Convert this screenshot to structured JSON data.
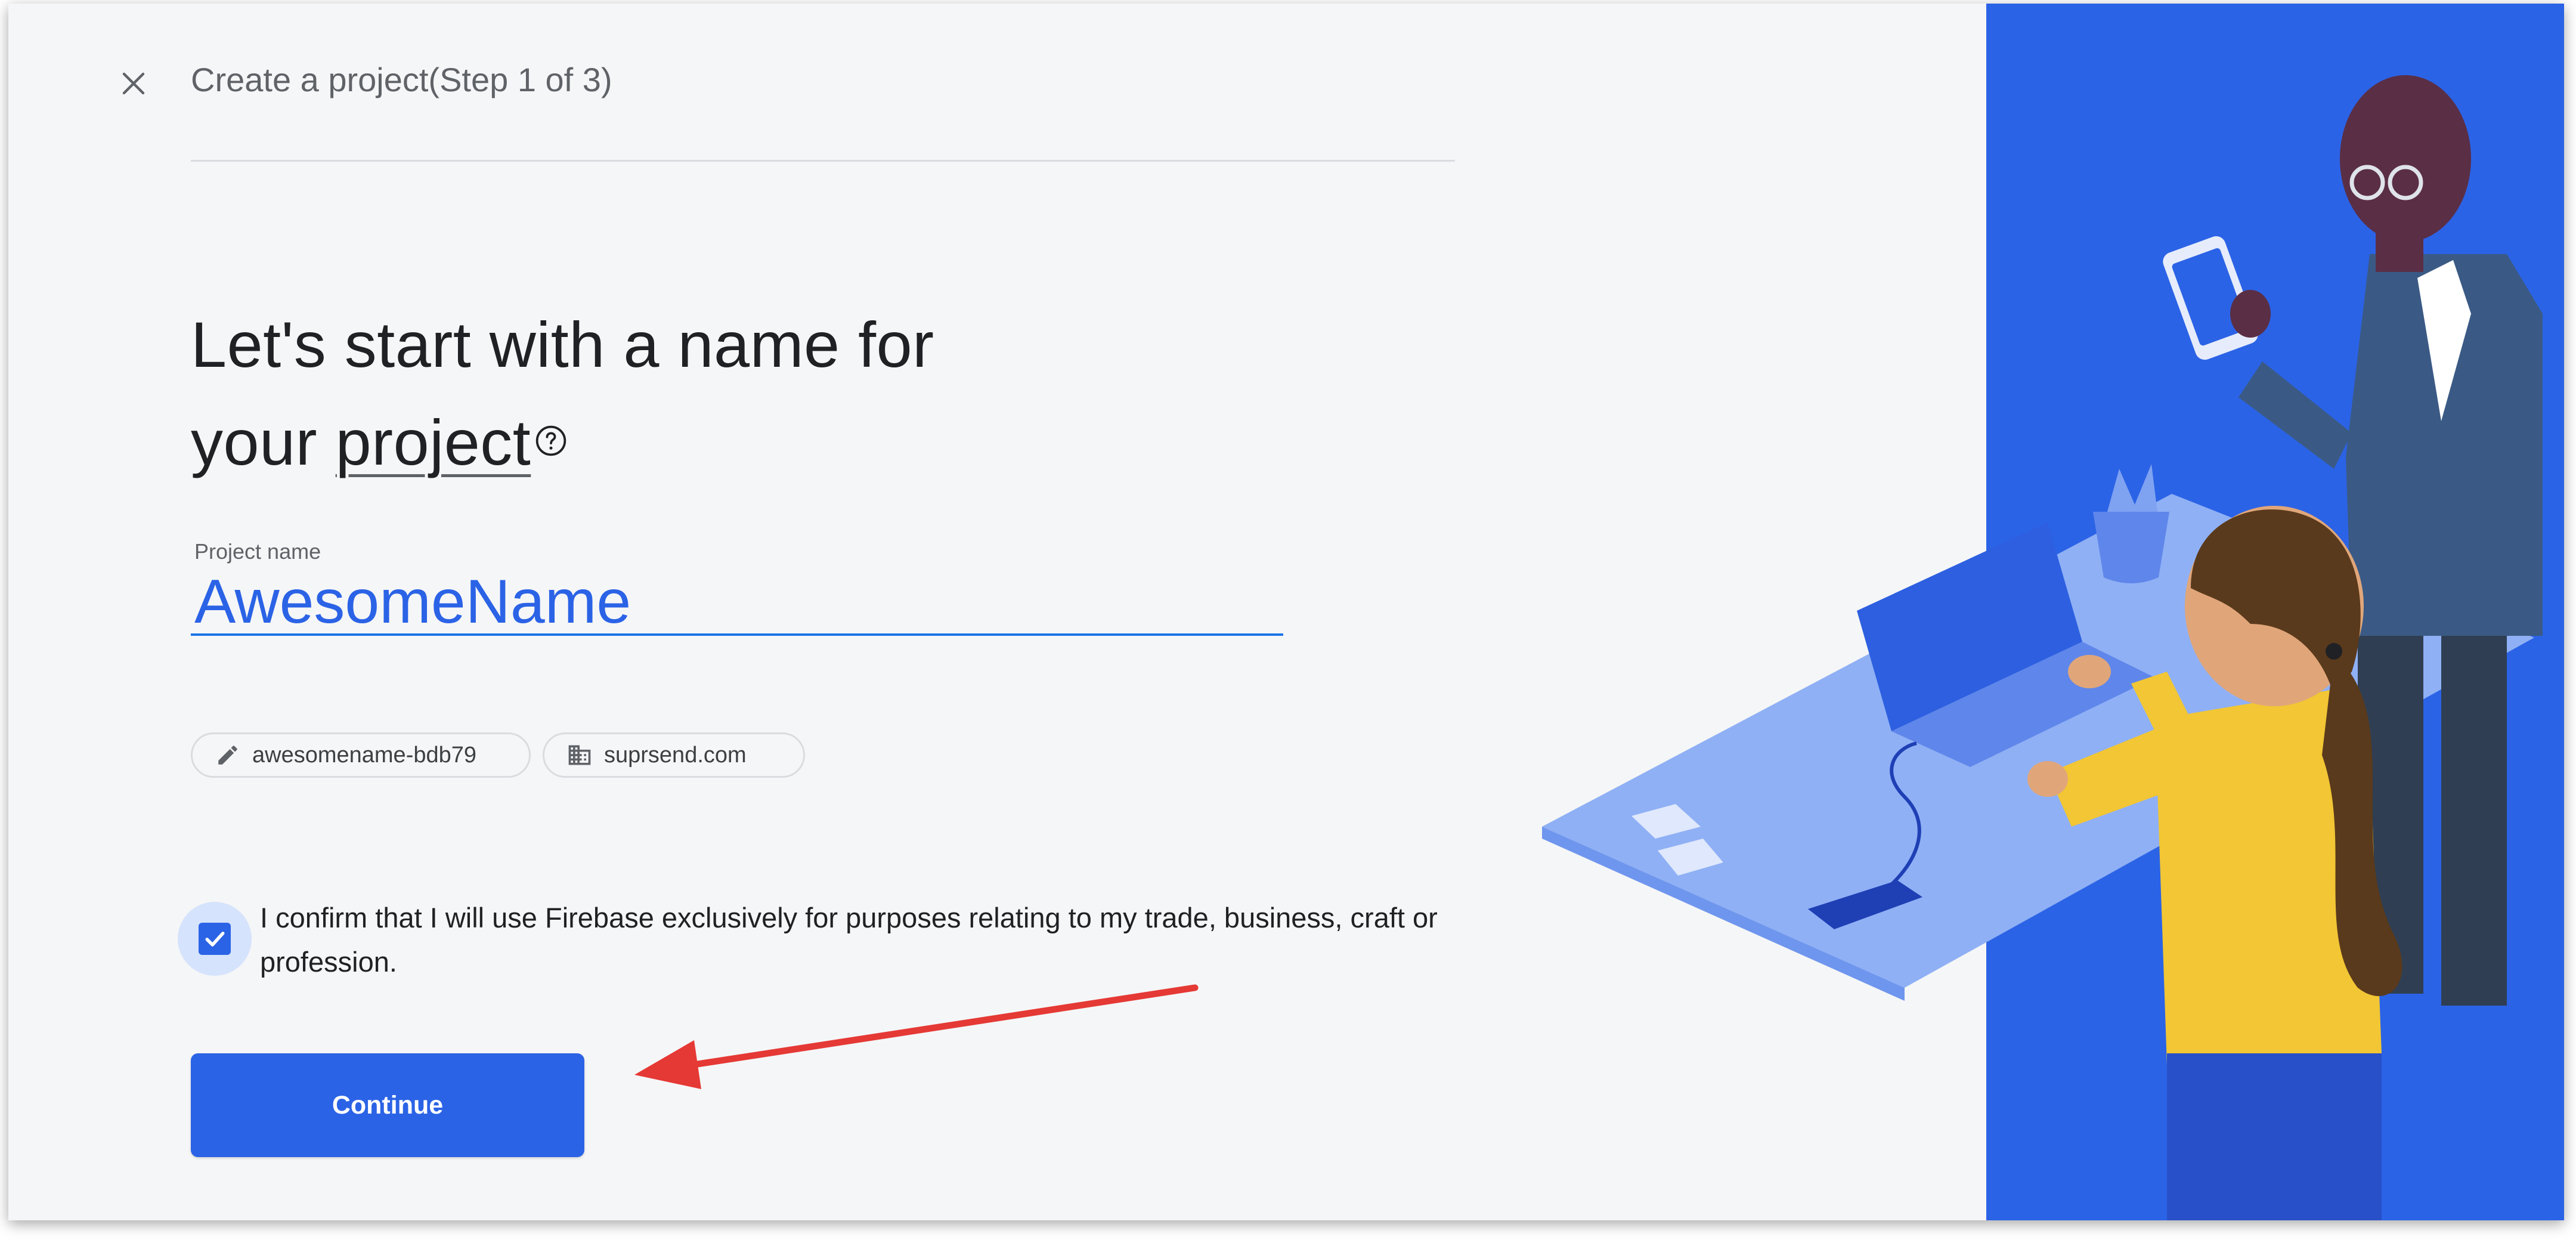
{
  "dialog": {
    "title": "Create a project(Step 1 of 3)",
    "close_icon": "close-icon"
  },
  "heading": {
    "line1": "Let's start with a name for",
    "line2_prefix": "your ",
    "line2_term": "project",
    "help_icon": "help-circle-icon"
  },
  "project_name": {
    "label": "Project name",
    "value": "AwesomeName"
  },
  "chips": {
    "project_id": {
      "icon": "pencil-icon",
      "text": "awesomename-bdb79"
    },
    "organization": {
      "icon": "building-icon",
      "text": "suprsend.com"
    }
  },
  "confirm": {
    "checked": true,
    "text": "I confirm that I will use Firebase exclusively for purposes relating to my trade, business, craft or profession."
  },
  "continue_button": {
    "label": "Continue"
  },
  "colors": {
    "accent": "#2b63e6",
    "illustration_background": "#2b63e6",
    "annotation_arrow": "#e53935"
  }
}
